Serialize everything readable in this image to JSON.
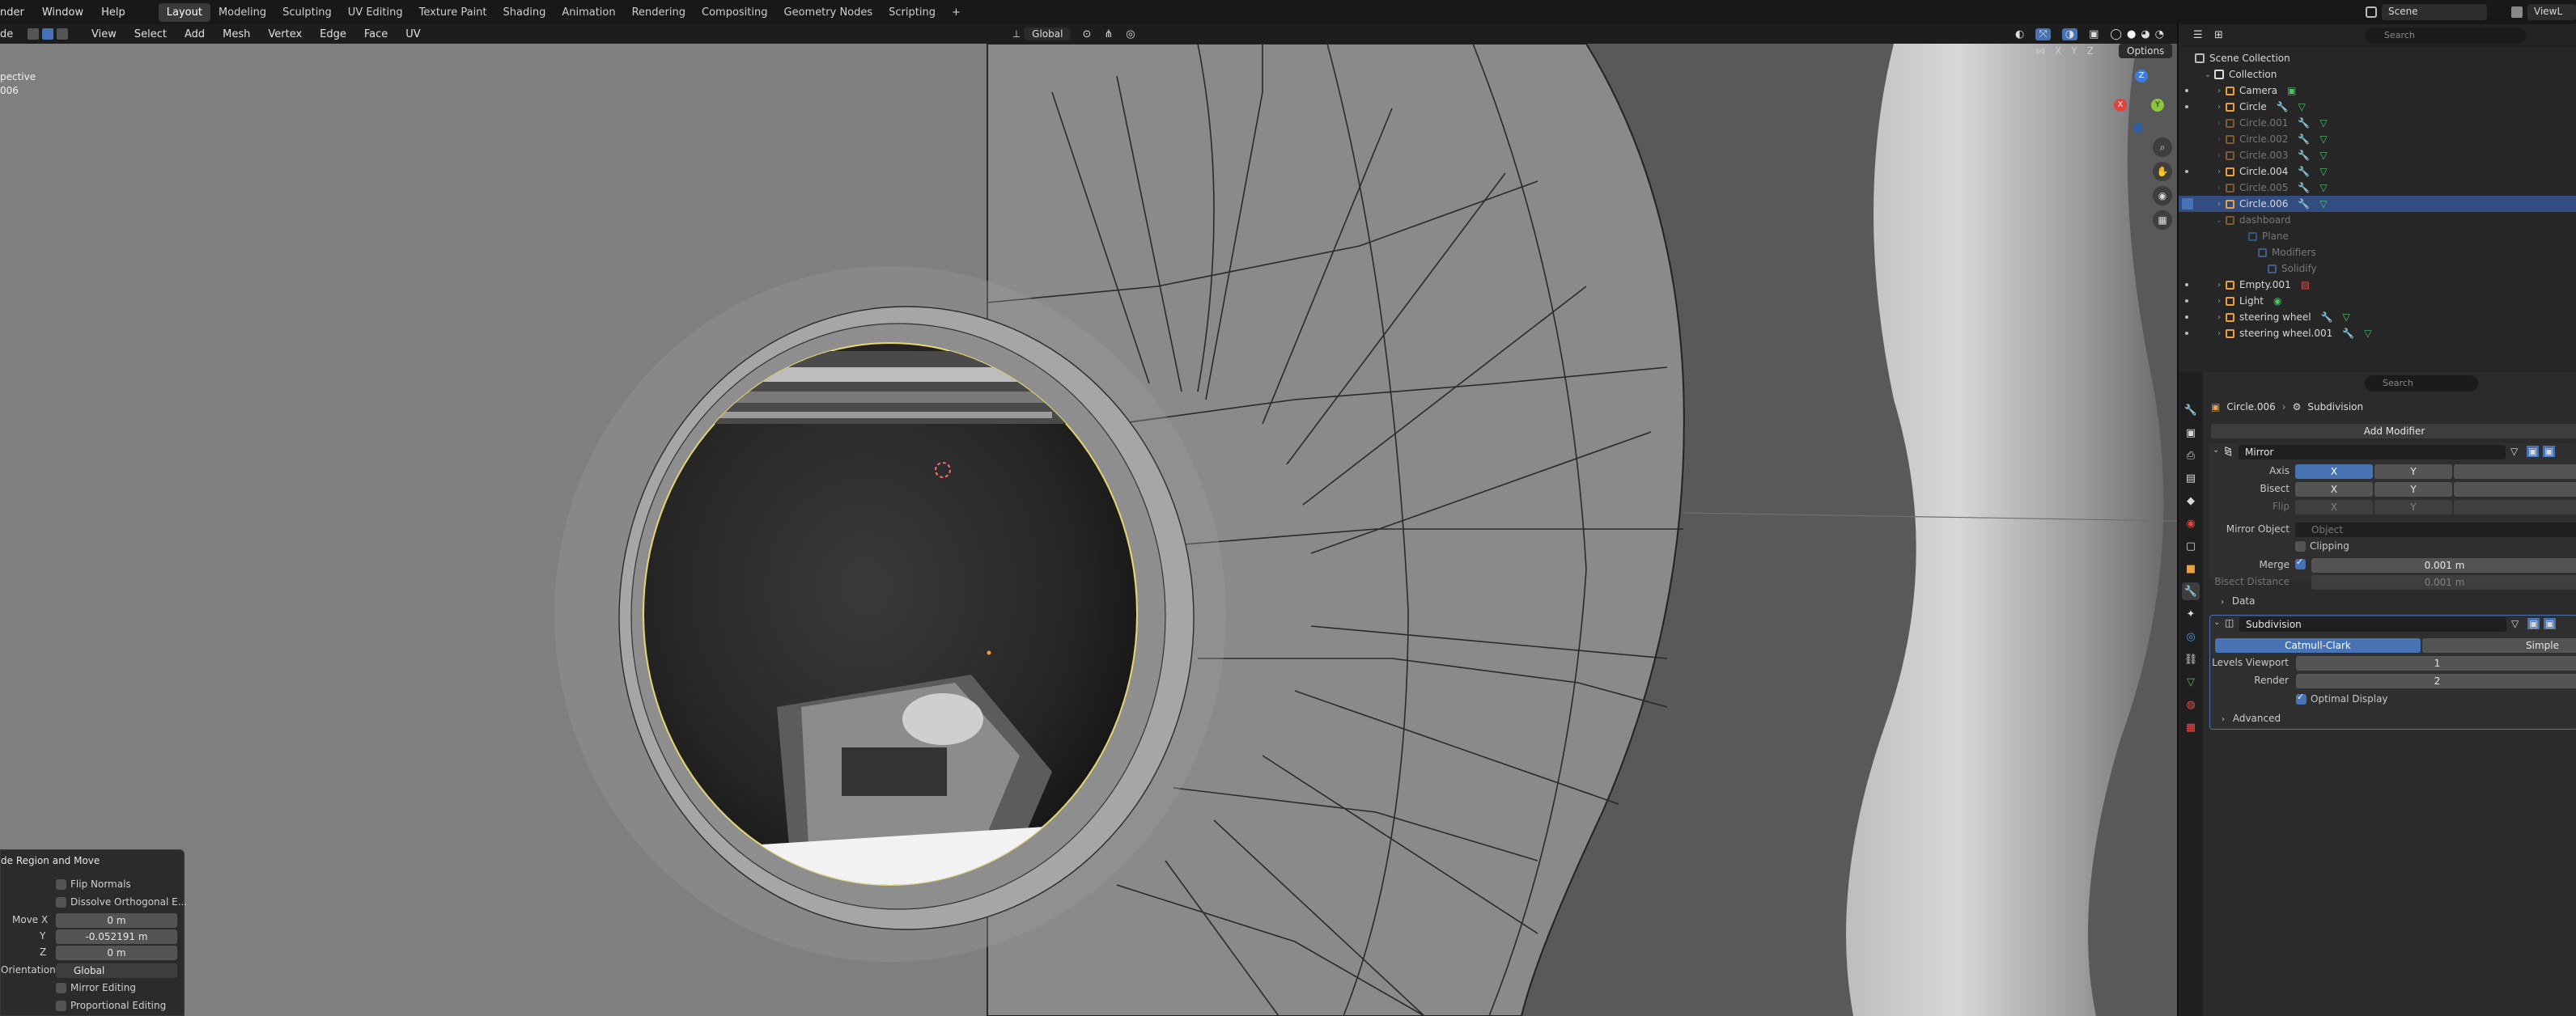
{
  "topbar": {
    "menus": [
      "nder",
      "Window",
      "Help"
    ],
    "workspaces": [
      "Layout",
      "Modeling",
      "Sculpting",
      "UV Editing",
      "Texture Paint",
      "Shading",
      "Animation",
      "Rendering",
      "Compositing",
      "Geometry Nodes",
      "Scripting"
    ],
    "active_workspace": "Layout",
    "add_tab": "+",
    "scene_name": "Scene",
    "view_layer": "ViewL"
  },
  "viewport_header": {
    "mode_fragment": "de",
    "menus": [
      "View",
      "Select",
      "Add",
      "Mesh",
      "Vertex",
      "Edge",
      "Face",
      "UV"
    ],
    "transform_orientation": "Global",
    "options_label": "Options",
    "axes": [
      "X",
      "Y",
      "Z"
    ]
  },
  "viewport": {
    "overlay_text": [
      "pective",
      "006"
    ],
    "gizmo_axes": {
      "x": "X",
      "y": "Y",
      "z": "Z"
    }
  },
  "outliner": {
    "search_placeholder": "Search",
    "root": "Scene Collection",
    "collection": "Collection",
    "items": [
      {
        "name": "Camera",
        "dim": false,
        "selected": false
      },
      {
        "name": "Circle",
        "dim": false,
        "selected": false
      },
      {
        "name": "Circle.001",
        "dim": true,
        "selected": false
      },
      {
        "name": "Circle.002",
        "dim": true,
        "selected": false
      },
      {
        "name": "Circle.003",
        "dim": true,
        "selected": false
      },
      {
        "name": "Circle.004",
        "dim": false,
        "selected": false
      },
      {
        "name": "Circle.005",
        "dim": true,
        "selected": false
      },
      {
        "name": "Circle.006",
        "dim": false,
        "selected": true
      },
      {
        "name": "dashboard",
        "dim": true,
        "selected": false
      },
      {
        "name": "Plane",
        "dim": true,
        "selected": false
      },
      {
        "name": "Modifiers",
        "dim": true,
        "selected": false
      },
      {
        "name": "Solidify",
        "dim": true,
        "selected": false
      },
      {
        "name": "Empty.001",
        "dim": false,
        "selected": false
      },
      {
        "name": "Light",
        "dim": false,
        "selected": false
      },
      {
        "name": "steering wheel",
        "dim": false,
        "selected": false
      },
      {
        "name": "steering wheel.001",
        "dim": false,
        "selected": false
      }
    ]
  },
  "properties": {
    "search_placeholder": "Search",
    "breadcrumb_object": "Circle.006",
    "breadcrumb_modifier": "Subdivision",
    "add_modifier": "Add Modifier",
    "mirror": {
      "name": "Mirror",
      "axis_label": "Axis",
      "bisect_label": "Bisect",
      "flip_label": "Flip",
      "x": "X",
      "y": "Y",
      "mirror_object_label": "Mirror Object",
      "mirror_object_placeholder": "Object",
      "clipping": "Clipping",
      "merge_label": "Merge",
      "merge_value": "0.001 m",
      "bisect_distance_label": "Bisect Distance",
      "bisect_distance_value": "0.001 m",
      "data_panel": "Data"
    },
    "subdivision": {
      "name": "Subdivision",
      "catmull": "Catmull-Clark",
      "simple": "Simple",
      "levels_viewport_label": "Levels Viewport",
      "levels_viewport": "1",
      "render_label": "Render",
      "render": "2",
      "optimal_display": "Optimal Display",
      "advanced": "Advanced"
    }
  },
  "redo_panel": {
    "title": "de Region and Move",
    "flip_normals": "Flip Normals",
    "dissolve": "Dissolve Orthogonal E...",
    "move_x_label": "Move X",
    "move_x": "0 m",
    "y_label": "Y",
    "y": "-0.052191 m",
    "z_label": "Z",
    "z": "0 m",
    "orientation_label": "Orientation",
    "orientation": "Global",
    "mirror_editing": "Mirror Editing",
    "proportional_editing": "Proportional Editing"
  },
  "colors": {
    "accent": "#4772b3",
    "selection": "#334d80",
    "viewport_bg": "#7c7c7c",
    "axis_x": "#e0433c",
    "axis_y": "#8cc63f",
    "axis_z": "#3d7ddb"
  }
}
